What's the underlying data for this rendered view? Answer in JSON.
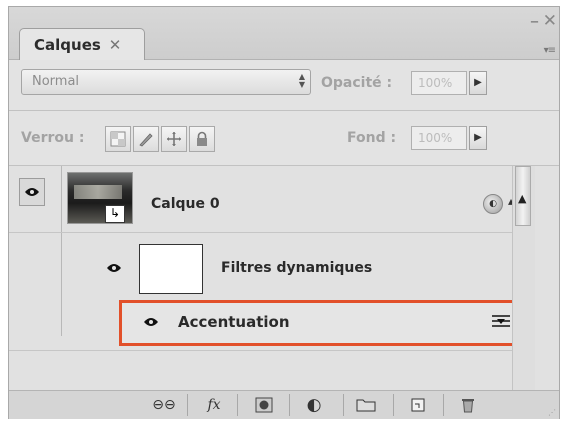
{
  "panel": {
    "tab_label": "Calques",
    "tab_close_glyph": "✕",
    "minimize_glyph": "–",
    "close_glyph": "✕",
    "menu_glyph": "▾≡"
  },
  "toolbar": {
    "blend_mode": "Normal",
    "opacity_label": "Opacité :",
    "opacity_value": "100%",
    "lock_label": "Verrou :",
    "fill_label": "Fond :",
    "fill_value": "100%"
  },
  "layers": [
    {
      "name": "Calque 0"
    },
    {
      "name": "Filtres dynamiques"
    },
    {
      "name": "Accentuation"
    }
  ],
  "icons": {
    "eye": "eye-icon",
    "lock_transparent": "lock-transparent-pixels-icon",
    "lock_image": "lock-image-pixels-icon",
    "lock_position": "lock-position-icon",
    "lock_all": "lock-all-icon",
    "smart_object": "smart-object-icon",
    "filter_options": "filter-blending-options-icon",
    "link": "link-layers-icon",
    "fx": "layer-style-icon",
    "mask": "add-mask-icon",
    "adjustment": "adjustment-layer-icon",
    "group": "new-group-icon",
    "new_layer": "new-layer-icon",
    "trash": "delete-layer-icon"
  },
  "bottom": {
    "link_glyph": "⊖⊖",
    "fx_glyph": "fx",
    "adjust_glyph": "◐",
    "trash_glyph": "🗑"
  },
  "colors": {
    "selection_border": "#e2502a",
    "panel_bg": "#e3e3e3"
  }
}
